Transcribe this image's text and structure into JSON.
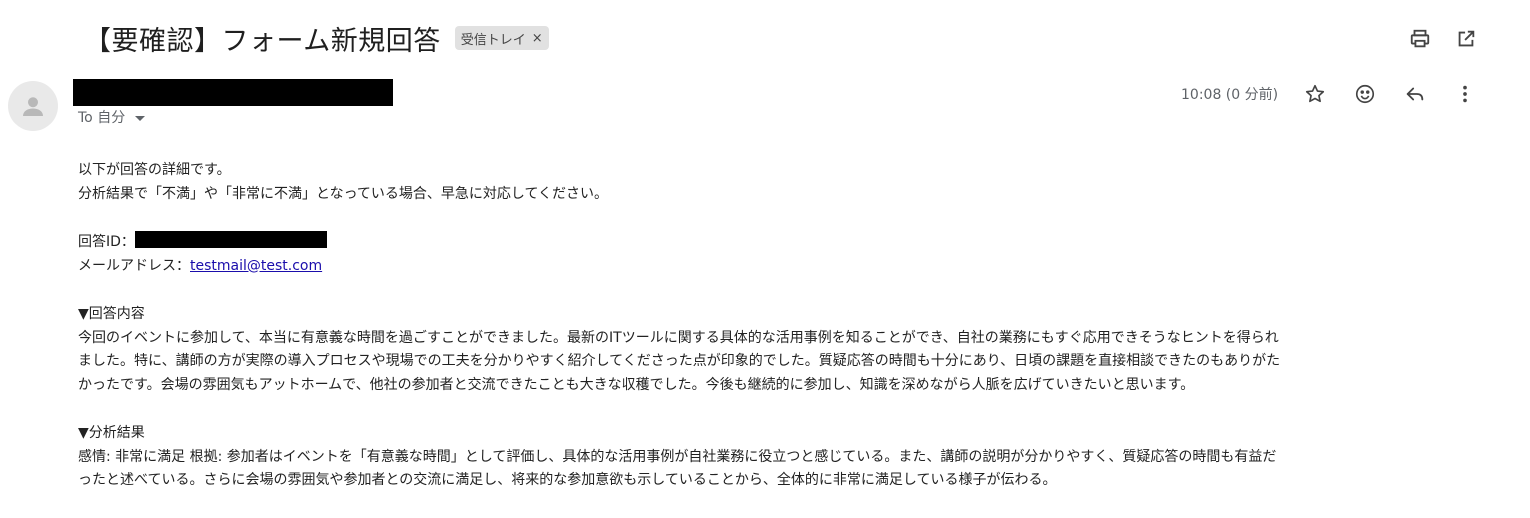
{
  "email": {
    "subject": "【要確認】フォーム新規回答",
    "label_chip": "受信トレイ",
    "label_close": "×",
    "recipient": "To 自分",
    "time": "10:08 (0 分前)"
  },
  "body": {
    "intro_line1": "以下が回答の詳細です。",
    "intro_line2": "分析結果で「不満」や「非常に不満」となっている場合、早急に対応してください。",
    "response_id_label": "回答ID：",
    "email_label": "メールアドレス：",
    "email_value": "testmail@test.com",
    "response_heading": "▼回答内容",
    "response_line1": "今回のイベントに参加して、本当に有意義な時間を過ごすことができました。最新のITツールに関する具体的な活用事例を知ることができ、自社の業務にもすぐ応用できそうなヒントを得られ",
    "response_line2": "ました。特に、講師の方が実際の導入プロセスや現場での工夫を分かりやすく紹介してくださった点が印象的でした。質疑応答の時間も十分にあり、日頃の課題を直接相談できたのもありがた",
    "response_line3": "かったです。会場の雰囲気もアットホームで、他社の参加者と交流できたことも大きな収穫でした。今後も継続的に参加し、知識を深めながら人脈を広げていきたいと思います。",
    "analysis_heading": "▼分析結果",
    "analysis_line1": "感情: 非常に満足 根拠: 参加者はイベントを「有意義な時間」として評価し、具体的な活用事例が自社業務に役立つと感じている。また、講師の説明が分かりやすく、質疑応答の時間も有益だ",
    "analysis_line2": "ったと述べている。さらに会場の雰囲気や参加者との交流に満足し、将来的な参加意欲も示していることから、全体的に非常に満足している様子が伝わる。"
  },
  "icons": {
    "top": [
      "print-icon",
      "open-in-new-window-icon"
    ],
    "message": [
      "star-icon",
      "emoji-icon",
      "reply-icon",
      "more-vert-icon"
    ],
    "avatar": "person-icon"
  },
  "colors": {
    "link": "#1a0dab",
    "chip_bg": "#e1e1e1",
    "meta_text": "#5f6368"
  }
}
